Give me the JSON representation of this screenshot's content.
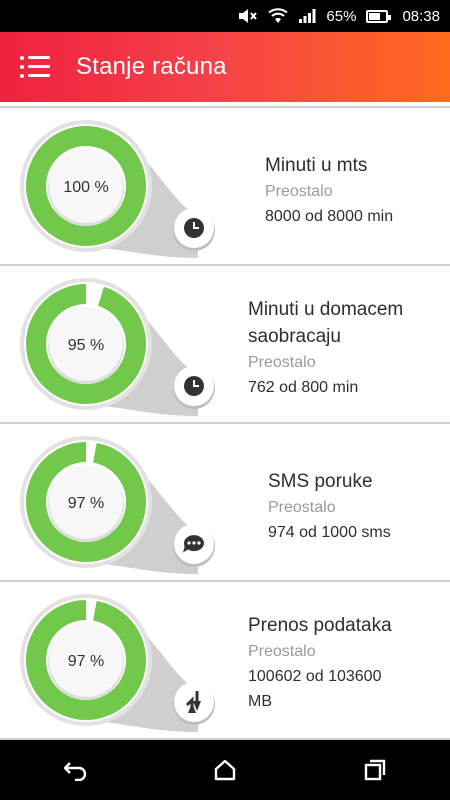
{
  "status_bar": {
    "battery_percent": "65%",
    "battery_level": 0.65,
    "time": "08:38",
    "icons": [
      "mute-icon",
      "wifi-icon",
      "signal-icon",
      "battery-icon"
    ]
  },
  "app_bar": {
    "title": "Stanje računa",
    "menu_icon": "menu-icon",
    "colors": {
      "gradient_start": "#f0213d",
      "gradient_end": "#ff6a1e"
    }
  },
  "colors": {
    "gauge_green": "#72c84b",
    "gauge_track": "#d9d9d9"
  },
  "items": [
    {
      "name_lines": [
        "Minuti u mts"
      ],
      "remaining_label": "Preostalo",
      "value_lines": [
        "8000 od 8000 min"
      ],
      "percent_label": "100 %",
      "fraction": 1.0,
      "icon": "clock-icon"
    },
    {
      "name_lines": [
        "Minuti u domacem",
        "saobracaju"
      ],
      "remaining_label": "Preostalo",
      "value_lines": [
        "762 od 800 min"
      ],
      "percent_label": "95 %",
      "fraction": 0.95,
      "icon": "clock-icon"
    },
    {
      "name_lines": [
        "SMS poruke"
      ],
      "remaining_label": "Preostalo",
      "value_lines": [
        "974 od 1000 sms"
      ],
      "percent_label": "97 %",
      "fraction": 0.97,
      "icon": "chat-bubble-icon"
    },
    {
      "name_lines": [
        "Prenos podataka"
      ],
      "remaining_label": "Preostalo",
      "value_lines": [
        "100602 od 103600",
        "MB"
      ],
      "percent_label": "97 %",
      "fraction": 0.97,
      "icon": "data-transfer-icon"
    }
  ],
  "nav_bar": {
    "icons": [
      "back-icon",
      "home-icon",
      "recents-icon"
    ]
  }
}
